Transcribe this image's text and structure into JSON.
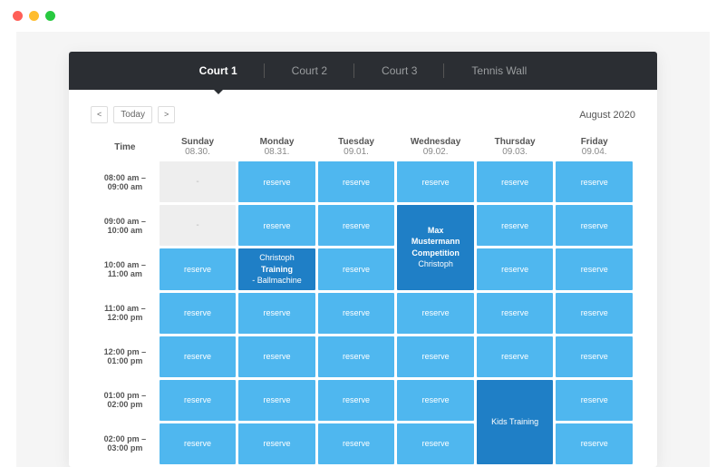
{
  "tabs": [
    "Court 1",
    "Court 2",
    "Court 3",
    "Tennis Wall"
  ],
  "active_tab": 0,
  "nav": {
    "today": "Today",
    "period": "August 2020"
  },
  "time_header": "Time",
  "days": [
    {
      "name": "Sunday",
      "date": "08.30."
    },
    {
      "name": "Monday",
      "date": "08.31."
    },
    {
      "name": "Tuesday",
      "date": "09.01."
    },
    {
      "name": "Wednesday",
      "date": "09.02."
    },
    {
      "name": "Thursday",
      "date": "09.03."
    },
    {
      "name": "Friday",
      "date": "09.04."
    }
  ],
  "reserve_label": "reserve",
  "unavailable_label": "-",
  "slots": [
    {
      "time": "08:00 am – 09:00 am",
      "cells": [
        {
          "type": "unavailable"
        },
        {
          "type": "reserve"
        },
        {
          "type": "reserve"
        },
        {
          "type": "reserve"
        },
        {
          "type": "reserve"
        },
        {
          "type": "reserve"
        }
      ]
    },
    {
      "time": "09:00 am – 10:00 am",
      "cells": [
        {
          "type": "unavailable"
        },
        {
          "type": "reserve"
        },
        {
          "type": "reserve"
        },
        {
          "type": "booked",
          "rowspan": 2,
          "lines": [
            "Max",
            "Mustermann",
            "Competition",
            "Christoph"
          ],
          "bold_lines": [
            0,
            1,
            2
          ]
        },
        {
          "type": "reserve"
        },
        {
          "type": "reserve"
        }
      ]
    },
    {
      "time": "10:00 am – 11:00 am",
      "cells": [
        {
          "type": "reserve"
        },
        {
          "type": "booked",
          "lines": [
            "Christoph",
            "Training",
            "- Ballmachine"
          ],
          "bold_lines": [
            1
          ]
        },
        {
          "type": "reserve"
        },
        {
          "type": "skip"
        },
        {
          "type": "reserve"
        },
        {
          "type": "reserve"
        }
      ]
    },
    {
      "time": "11:00 am – 12:00 pm",
      "cells": [
        {
          "type": "reserve"
        },
        {
          "type": "reserve"
        },
        {
          "type": "reserve"
        },
        {
          "type": "reserve"
        },
        {
          "type": "reserve"
        },
        {
          "type": "reserve"
        }
      ]
    },
    {
      "time": "12:00 pm – 01:00 pm",
      "cells": [
        {
          "type": "reserve"
        },
        {
          "type": "reserve"
        },
        {
          "type": "reserve"
        },
        {
          "type": "reserve"
        },
        {
          "type": "reserve"
        },
        {
          "type": "reserve"
        }
      ]
    },
    {
      "time": "01:00 pm – 02:00 pm",
      "cells": [
        {
          "type": "reserve"
        },
        {
          "type": "reserve"
        },
        {
          "type": "reserve"
        },
        {
          "type": "reserve"
        },
        {
          "type": "booked",
          "rowspan": 2,
          "lines": [
            "Kids Training"
          ],
          "bold_lines": []
        },
        {
          "type": "reserve"
        }
      ]
    },
    {
      "time": "02:00 pm – 03:00 pm",
      "cells": [
        {
          "type": "reserve"
        },
        {
          "type": "reserve"
        },
        {
          "type": "reserve"
        },
        {
          "type": "reserve"
        },
        {
          "type": "skip"
        },
        {
          "type": "reserve"
        }
      ]
    }
  ]
}
